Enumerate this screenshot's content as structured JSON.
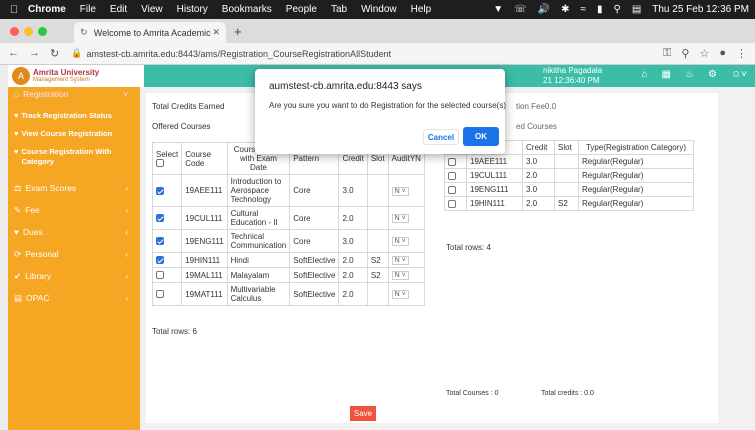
{
  "menubar": {
    "items": [
      "Chrome",
      "File",
      "Edit",
      "View",
      "History",
      "Bookmarks",
      "People",
      "Tab",
      "Window",
      "Help"
    ],
    "datetime": "Thu 25 Feb  12:36 PM"
  },
  "browser": {
    "tab_title": "Welcome to Amrita Academic I",
    "url": "amstest-cb.amrita.edu:8443/ams/Registration_CourseRegistrationAllStudent"
  },
  "app": {
    "logo_line1": "Amrita University",
    "logo_line2": "Management System",
    "user_name": "nikitha Pagadala",
    "user_time": "21 12:36:40 PM"
  },
  "sidebar": {
    "top_item": "Registration",
    "sub_items": [
      "Track Registration Status",
      "View Course Registration",
      "Course Registration With Category"
    ],
    "items": [
      "Exam Scores",
      "Fee",
      "Dues",
      "Personal",
      "Library",
      "OPAC"
    ]
  },
  "main": {
    "total_credits_label": "Total Credits Earned",
    "offered_label": "Offered Courses",
    "fee_label": "tion Fee0.0",
    "selected_label": "ed Courses",
    "offered_headers": [
      "Select",
      "Course Code",
      "Course Name with Exam Date",
      "Pattern",
      "Credit",
      "Slot",
      "AuditYN"
    ],
    "offered_rows": [
      {
        "checked": true,
        "code": "19AEE111",
        "name": "Introduction to Aerospace Technology",
        "pattern": "Core",
        "credit": "3.0",
        "slot": "",
        "audit": "N"
      },
      {
        "checked": true,
        "code": "19CUL111",
        "name": "Cultural Education - II",
        "pattern": "Core",
        "credit": "2.0",
        "slot": "",
        "audit": "N"
      },
      {
        "checked": true,
        "code": "19ENG111",
        "name": "Technical Communication",
        "pattern": "Core",
        "credit": "3.0",
        "slot": "",
        "audit": "N"
      },
      {
        "checked": true,
        "code": "19HIN111",
        "name": "Hindi",
        "pattern": "SoftElective",
        "credit": "2.0",
        "slot": "S2",
        "audit": "N"
      },
      {
        "checked": false,
        "code": "19MAL111",
        "name": "Malayalam",
        "pattern": "SoftElective",
        "credit": "2.0",
        "slot": "S2",
        "audit": "N"
      },
      {
        "checked": false,
        "code": "19MAT111",
        "name": "Multivariable Calculus",
        "pattern": "SoftElective",
        "credit": "2.0",
        "slot": "",
        "audit": "N"
      }
    ],
    "offered_total": "Total rows: 6",
    "selected_headers": [
      "",
      "Code",
      "Credit",
      "Slot",
      "Type(Registration Category)"
    ],
    "selected_rows": [
      {
        "code": "19AEE111",
        "credit": "3.0",
        "slot": "",
        "type": "Regular(Regular)"
      },
      {
        "code": "19CUL111",
        "credit": "2.0",
        "slot": "",
        "type": "Regular(Regular)"
      },
      {
        "code": "19ENG111",
        "credit": "3.0",
        "slot": "",
        "type": "Regular(Regular)"
      },
      {
        "code": "19HIN111",
        "credit": "2.0",
        "slot": "S2",
        "type": "Regular(Regular)"
      }
    ],
    "selected_total": "Total rows: 4",
    "total_courses": "Total Courses : 0",
    "total_credits": "Total credits : 0.0",
    "save_label": "Save"
  },
  "dialog": {
    "title": "aumstest-cb.amrita.edu:8443 says",
    "message": "Are you sure you want to do Registration for the selected course(s)",
    "cancel_label": "Cancel",
    "ok_label": "OK"
  },
  "colors": {
    "header": "#3cbda8",
    "sidebar": "#f5a623",
    "save": "#f0523b",
    "ok": "#1a73e8"
  }
}
